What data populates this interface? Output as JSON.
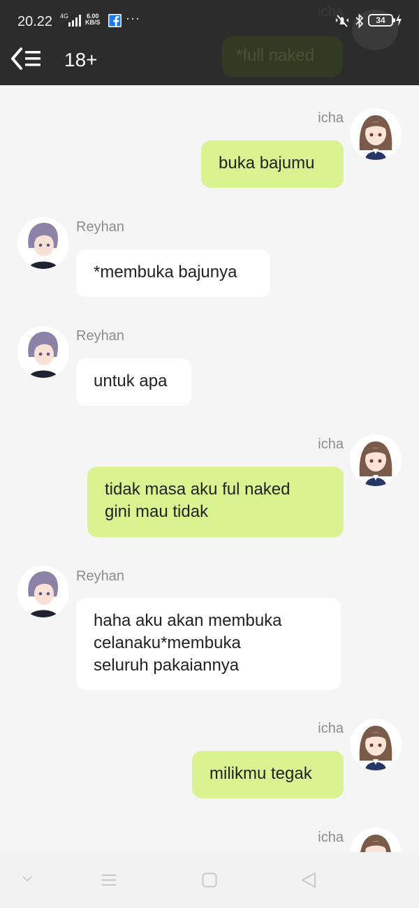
{
  "status_bar": {
    "time": "20.22",
    "network": "4G",
    "speed_value": "6.00",
    "speed_unit": "KB/S",
    "more": "···",
    "battery": "34"
  },
  "header": {
    "title": "18+",
    "ghost_name": "icha",
    "ghost_text": "*full naked"
  },
  "messages": [
    {
      "sender": "icha",
      "text": "buka bajumu"
    },
    {
      "sender": "Reyhan",
      "text": "*membuka bajunya"
    },
    {
      "sender": "Reyhan",
      "text": "untuk apa"
    },
    {
      "sender": "icha",
      "lines": [
        "tidak masa aku ful naked",
        "gini mau tidak"
      ]
    },
    {
      "sender": "Reyhan",
      "lines": [
        "haha aku akan membuka",
        "celanaku*membuka",
        "seluruh pakaiannya"
      ]
    },
    {
      "sender": "icha",
      "text": "milikmu tegak"
    },
    {
      "sender": "icha"
    }
  ],
  "colors": {
    "header_bg": "#2c2c2c",
    "outgoing_bubble": "#d8f38f",
    "incoming_bubble": "#ffffff",
    "chat_bg": "#f5f5f5"
  },
  "icons": {
    "back": "back-menu-icon",
    "nav": [
      "collapse-icon",
      "recents-icon",
      "home-icon",
      "back-triangle-icon"
    ]
  }
}
